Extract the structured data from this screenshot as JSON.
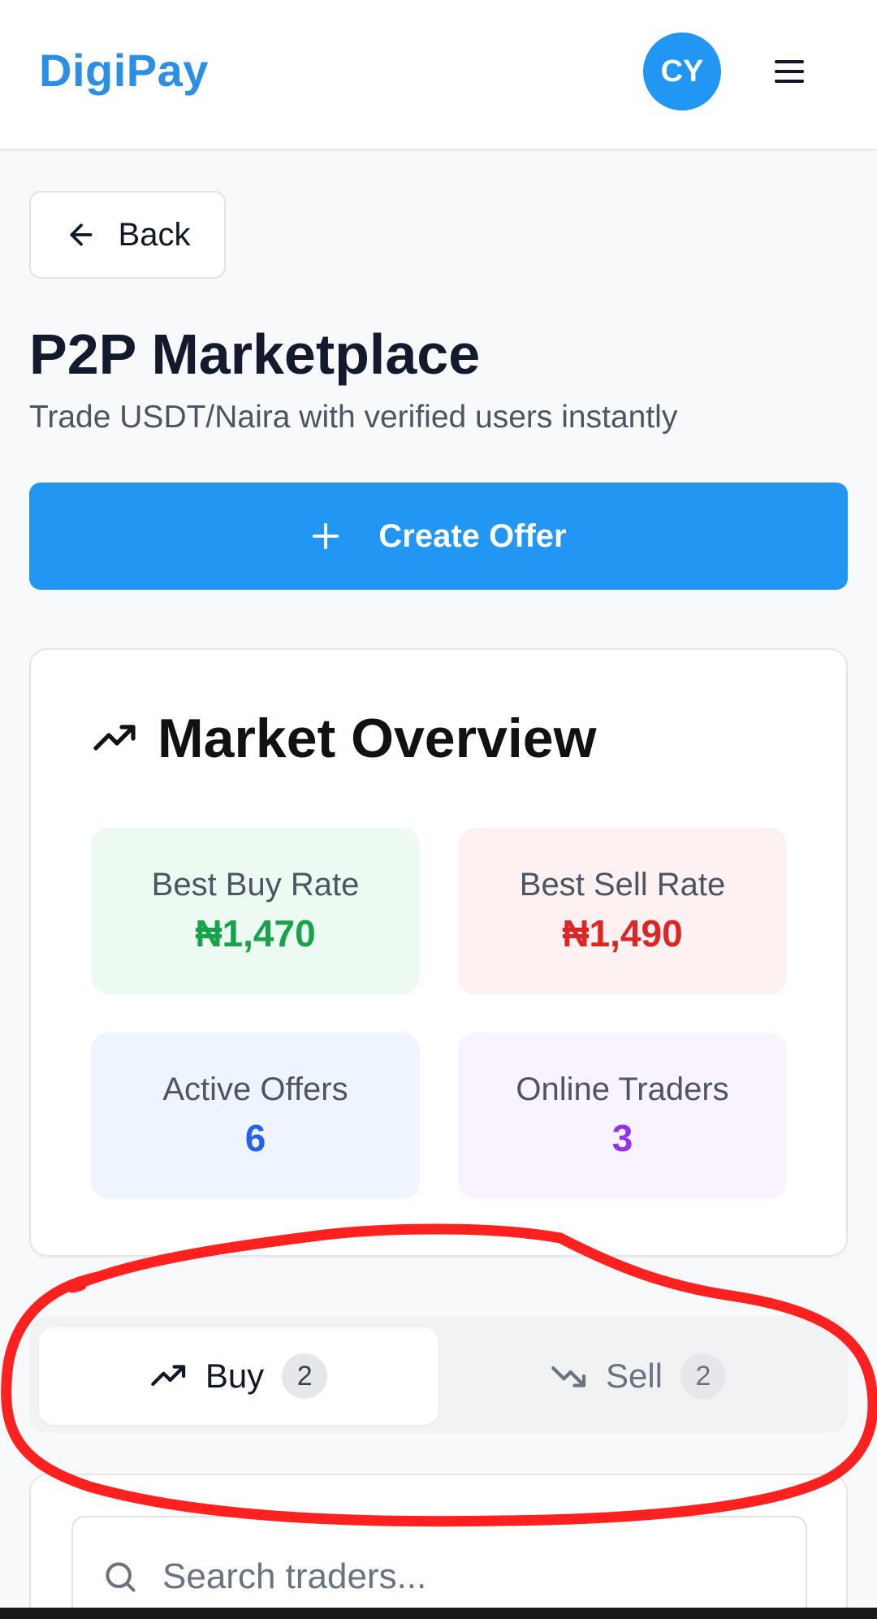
{
  "header": {
    "brand": "DigiPay",
    "avatar_initials": "CY"
  },
  "back_label": "Back",
  "page": {
    "title": "P2P Marketplace",
    "subtitle": "Trade USDT/Naira with verified users instantly"
  },
  "create_offer_label": "Create Offer",
  "market_overview": {
    "title": "Market Overview",
    "stats": {
      "best_buy": {
        "label": "Best Buy Rate",
        "value": "₦1,470"
      },
      "best_sell": {
        "label": "Best Sell Rate",
        "value": "₦1,490"
      },
      "active_offers": {
        "label": "Active Offers",
        "value": "6"
      },
      "online_traders": {
        "label": "Online Traders",
        "value": "3"
      }
    }
  },
  "tabs": [
    {
      "label": "Buy",
      "count": "2",
      "active": true,
      "icon": "trending-up-icon"
    },
    {
      "label": "Sell",
      "count": "2",
      "active": false,
      "icon": "trending-down-icon"
    }
  ],
  "search": {
    "placeholder": "Search traders...",
    "value": ""
  },
  "colors": {
    "brand": "#2b8fe6",
    "primary": "#2196f3",
    "buy_green": "#16a34a",
    "sell_red": "#dc2626",
    "offers_blue": "#2563eb",
    "traders_purple": "#9333ea",
    "annotation_red": "#ff2020"
  }
}
